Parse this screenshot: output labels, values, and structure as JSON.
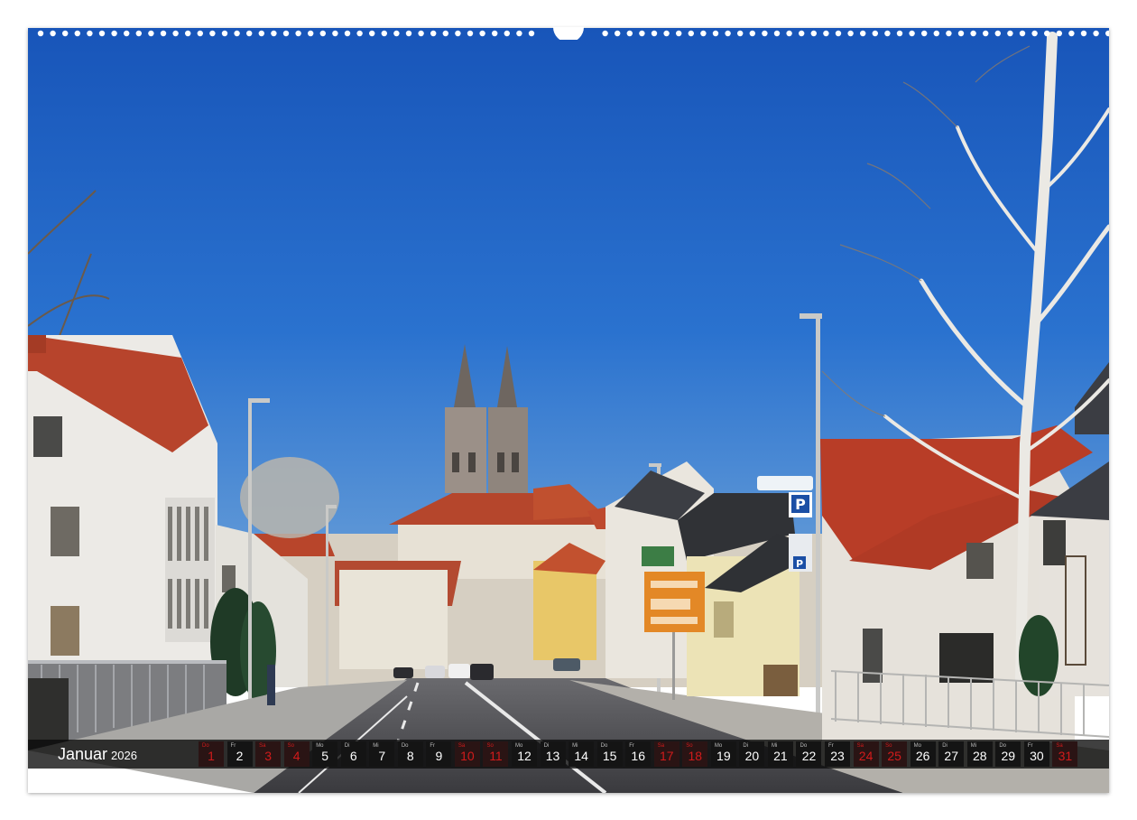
{
  "calendar": {
    "month": "Januar",
    "year": "2026",
    "days": [
      {
        "wd": "Do",
        "num": "1",
        "red": true
      },
      {
        "wd": "Fr",
        "num": "2",
        "red": false
      },
      {
        "wd": "Sa",
        "num": "3",
        "red": true
      },
      {
        "wd": "So",
        "num": "4",
        "red": true
      },
      {
        "wd": "Mo",
        "num": "5",
        "red": false
      },
      {
        "wd": "Di",
        "num": "6",
        "red": false
      },
      {
        "wd": "Mi",
        "num": "7",
        "red": false
      },
      {
        "wd": "Do",
        "num": "8",
        "red": false
      },
      {
        "wd": "Fr",
        "num": "9",
        "red": false
      },
      {
        "wd": "Sa",
        "num": "10",
        "red": true
      },
      {
        "wd": "So",
        "num": "11",
        "red": true
      },
      {
        "wd": "Mo",
        "num": "12",
        "red": false
      },
      {
        "wd": "Di",
        "num": "13",
        "red": false
      },
      {
        "wd": "Mi",
        "num": "14",
        "red": false
      },
      {
        "wd": "Do",
        "num": "15",
        "red": false
      },
      {
        "wd": "Fr",
        "num": "16",
        "red": false
      },
      {
        "wd": "Sa",
        "num": "17",
        "red": true
      },
      {
        "wd": "So",
        "num": "18",
        "red": true
      },
      {
        "wd": "Mo",
        "num": "19",
        "red": false
      },
      {
        "wd": "Di",
        "num": "20",
        "red": false
      },
      {
        "wd": "Mi",
        "num": "21",
        "red": false
      },
      {
        "wd": "Do",
        "num": "22",
        "red": false
      },
      {
        "wd": "Fr",
        "num": "23",
        "red": false
      },
      {
        "wd": "Sa",
        "num": "24",
        "red": true
      },
      {
        "wd": "So",
        "num": "25",
        "red": true
      },
      {
        "wd": "Mo",
        "num": "26",
        "red": false
      },
      {
        "wd": "Di",
        "num": "27",
        "red": false
      },
      {
        "wd": "Mi",
        "num": "28",
        "red": false
      },
      {
        "wd": "Do",
        "num": "29",
        "red": false
      },
      {
        "wd": "Fr",
        "num": "30",
        "red": false
      },
      {
        "wd": "Sa",
        "num": "31",
        "red": true
      }
    ]
  },
  "photo": {
    "signs": {
      "parking": "P",
      "parking_small": "P"
    }
  },
  "colors": {
    "sky": "#1f66c4",
    "roof": "#b9452d",
    "weekend": "#d21b1b",
    "strip": "#0a0a0a"
  }
}
